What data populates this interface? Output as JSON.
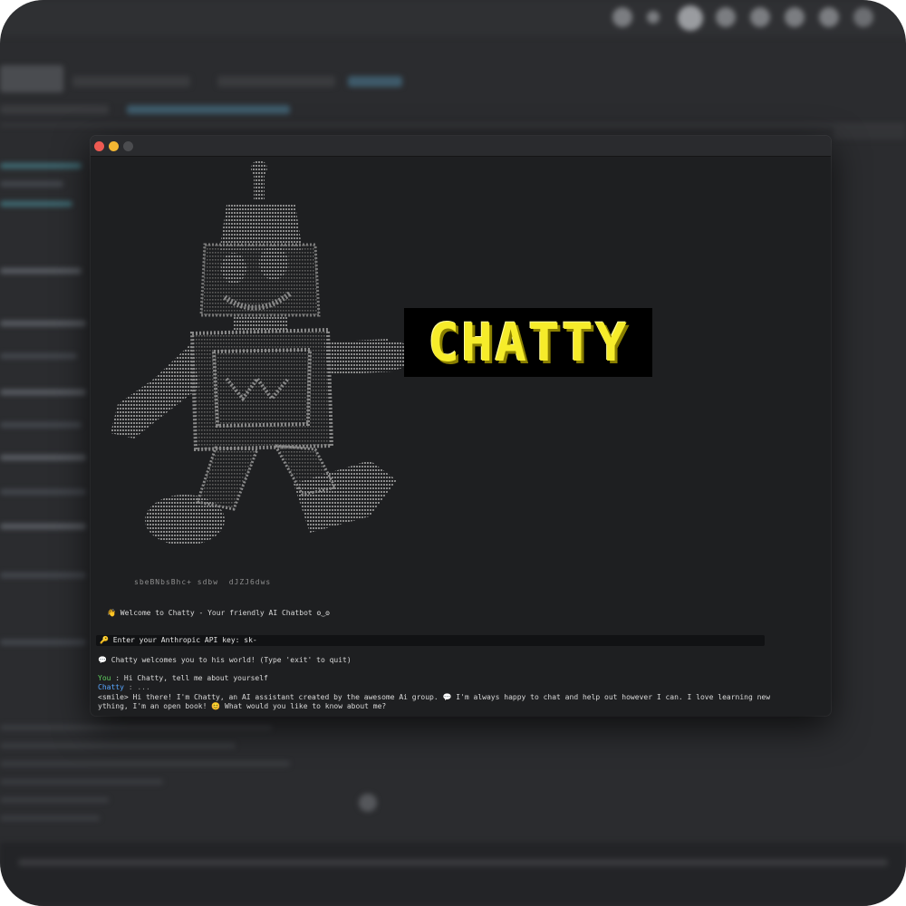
{
  "terminal": {
    "logo_text": "CHATTY",
    "art_scribble": "sbeBNbsBhc+ sdbw  dJZJ6dws",
    "welcome_text": "👋 Welcome to Chatty - Your friendly AI Chatbot ʘ‿ʘ",
    "api_prompt": "🔑 Enter your Anthropic API key: sk-",
    "intro_text": "💬 Chatty welcomes you to his world! (Type 'exit' to quit)",
    "user_label": "You",
    "user_message": " : Hi Chatty, tell me about yourself",
    "bot_label": "Chatty",
    "bot_status": " : ...",
    "reply_line1": "<smile> Hi there! I'm Chatty, an AI assistant created by the awesome Ai group. 💬 I'm always happy to chat and help out however I can. I love learning new",
    "reply_line2": "ything, I'm an open book! 😊 What would you like to know about me?"
  },
  "colors": {
    "logo_yellow": "#f6ec2a",
    "user_green": "#5fd35f",
    "bot_blue": "#58a6ff",
    "terminal_bg": "#1e1f21"
  },
  "icons": {
    "close": "close-icon",
    "minimize": "minimize-icon",
    "zoom": "zoom-icon"
  }
}
